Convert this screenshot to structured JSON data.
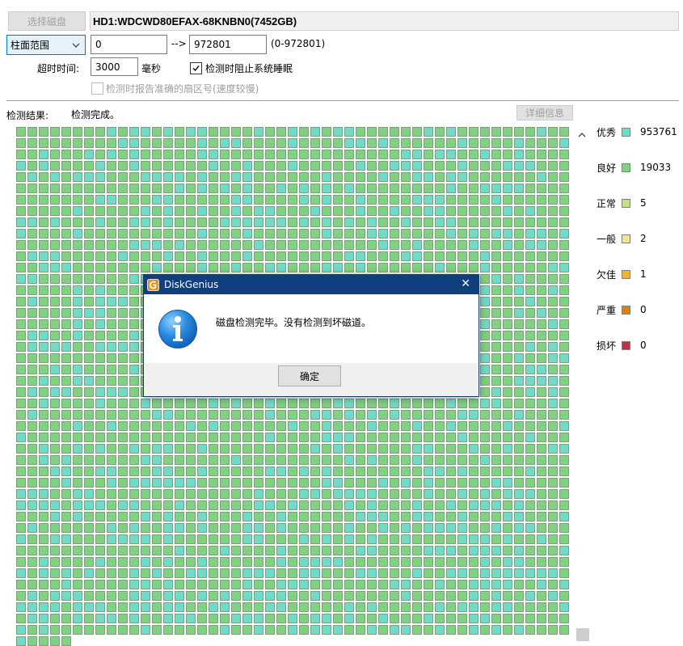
{
  "toolbar": {
    "select_disk_label": "选择磁盘",
    "disk_name": "HD1:WDCWD80EFAX-68KNBN0(7452GB)"
  },
  "range": {
    "mode_selected": "柱面范围",
    "start_value": "0",
    "arrow": "-->",
    "end_value": "972801",
    "hint": "(0-972801)"
  },
  "timeout": {
    "label": "超时时间:",
    "value": "3000",
    "unit": "毫秒",
    "prevent_sleep_label": "检测时阻止系统睡眠",
    "prevent_sleep_checked": true,
    "report_sector_label": "检测时报告准确的扇区号(速度较慢)",
    "report_sector_checked": false
  },
  "result": {
    "label": "检测结果:",
    "status": "检测完成。",
    "details_button": "详细信息"
  },
  "legend": [
    {
      "name": "优秀",
      "count": "953761",
      "color": "#6fdcc8"
    },
    {
      "name": "良好",
      "count": "19033",
      "color": "#7fd27f"
    },
    {
      "name": "正常",
      "count": "5",
      "color": "#c6de85"
    },
    {
      "name": "一般",
      "count": "2",
      "color": "#f2e493"
    },
    {
      "name": "欠佳",
      "count": "1",
      "color": "#f0b42d"
    },
    {
      "name": "严重",
      "count": "0",
      "color": "#d9830f"
    },
    {
      "name": "损坏",
      "count": "0",
      "color": "#c0304a"
    }
  ],
  "grid": {
    "cell_border": "#7e9f7e",
    "colors": [
      "#6fdcc8",
      "#7fd27f"
    ]
  },
  "dialog": {
    "title": "DiskGenius",
    "message": "磁盘检测完毕。没有检测到坏磁道。",
    "ok_label": "确定",
    "close_glyph": "✕"
  }
}
